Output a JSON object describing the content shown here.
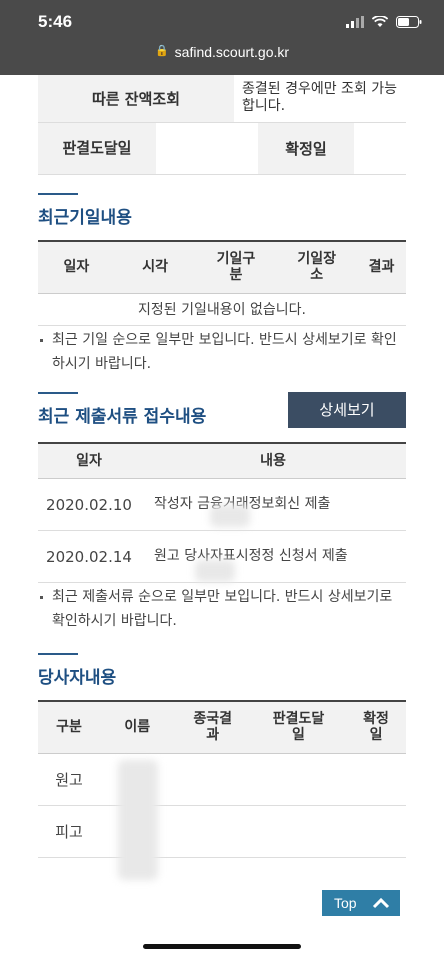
{
  "status_bar": {
    "time": "5:46"
  },
  "browser": {
    "url": "safind.scourt.go.kr"
  },
  "top_table": {
    "row1_left": "따른 잔액조회",
    "row1_right": "종결된 경우에만 조회 가능합니다.",
    "row2_label1": "판결도달일",
    "row2_label2": "확정일"
  },
  "hearings": {
    "title": "최근기일내용",
    "columns": [
      "일자",
      "시각",
      "기일구분",
      "기일장소",
      "결과"
    ],
    "empty_message": "지정된 기일내용이 없습니다.",
    "note": "최근 기일 순으로 일부만 보입니다. 반드시 상세보기로 확인하시기 바랍니다."
  },
  "filings": {
    "title": "최근 제출서류 접수내용",
    "detail_button": "상세보기",
    "columns": [
      "일자",
      "내용"
    ],
    "rows": [
      {
        "date": "2020.02.10",
        "content": "작성자 금융거래정보회신 제출"
      },
      {
        "date": "2020.02.14",
        "content": "원고 당사자표시정정 신청서 제출"
      }
    ],
    "note": "최근 제출서류 순으로 일부만 보입니다. 반드시 상세보기로 확인하시기 바랍니다."
  },
  "parties": {
    "title": "당사자내용",
    "columns": [
      "구분",
      "이름",
      "종국결과",
      "판결도달일",
      "확정일"
    ],
    "rows": [
      {
        "type": "원고"
      },
      {
        "type": "피고"
      }
    ]
  },
  "top_button": {
    "label": "Top"
  }
}
